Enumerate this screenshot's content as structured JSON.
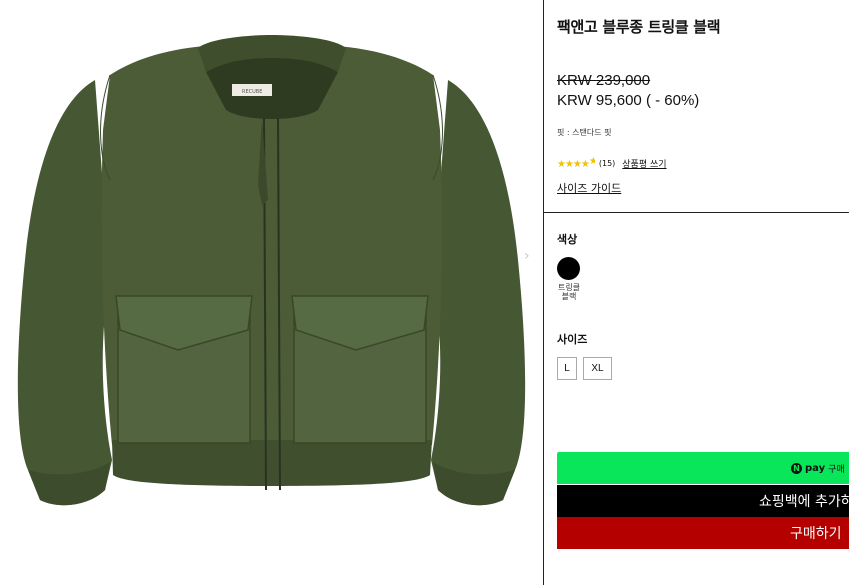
{
  "product": {
    "title": "팩앤고 블루종 트링클 블랙",
    "original_price": "KRW 239,000",
    "sale_price": "KRW 95,600 ( - 60%)",
    "fit": "핏 : 스탠다드 핏",
    "rating": {
      "stars_filled": 4.5,
      "stars_total": 5,
      "review_count": "(15)"
    },
    "write_review_link": "상품평 쓰기",
    "size_guide_link": "사이즈 가이드",
    "label_tag_text": "RECUBE"
  },
  "gallery": {
    "next_arrow": "›",
    "jacket_color": "#4a5b36"
  },
  "color_section": {
    "label": "색상",
    "options": [
      {
        "name": "트링클\n블랙",
        "swatch": "#000000"
      }
    ]
  },
  "size_section": {
    "label": "사이즈",
    "options": [
      "L",
      "XL"
    ]
  },
  "buttons": {
    "npay_logo": "N",
    "npay_text": "pay",
    "npay_buy": "구매",
    "add_to_cart": "쇼핑백에 추가하",
    "buy_now": "구매하기"
  },
  "colors": {
    "npay_green": "#09e65a",
    "buy_red": "#b50000",
    "star_yellow": "#f2c200"
  }
}
